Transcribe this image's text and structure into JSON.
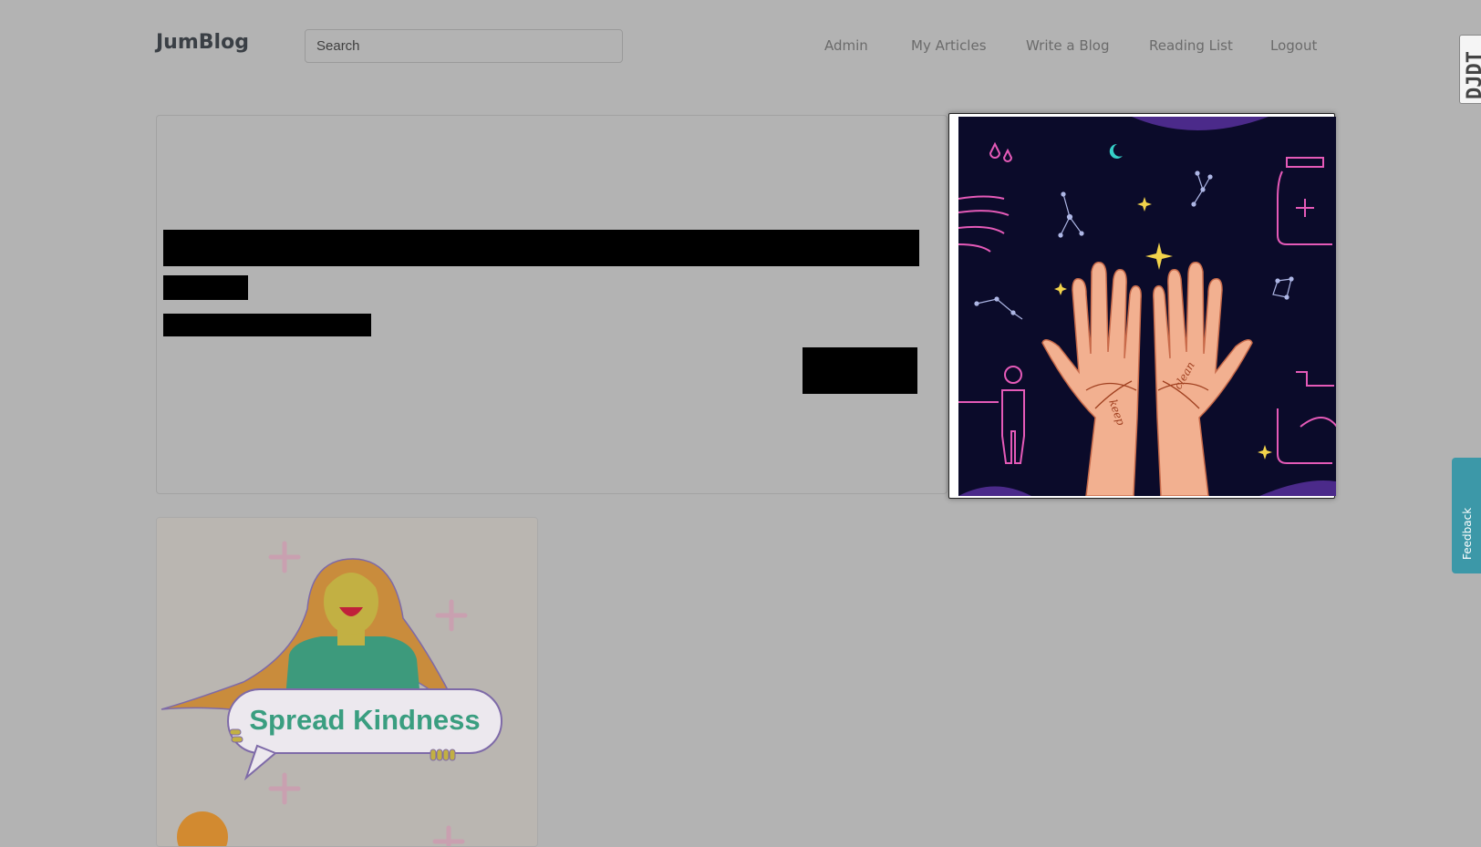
{
  "header": {
    "brand": "JumBlog",
    "search_placeholder": "Search",
    "nav": [
      {
        "label": "Admin"
      },
      {
        "label": "My Articles"
      },
      {
        "label": "Write a Blog"
      },
      {
        "label": "Reading List"
      },
      {
        "label": "Logout"
      }
    ]
  },
  "popup_image": {
    "palm_words": [
      "keep",
      "clean"
    ]
  },
  "card2": {
    "image_text": "Spread Kindness"
  },
  "side_tabs": {
    "top_tab_text": "DJDT",
    "feedback": "Feedback"
  },
  "colors": {
    "overlay": "#b3b3b3",
    "feedback_tab": "#3c98a8",
    "night_sky": "#0b0b2a",
    "kindness_green": "#3a9e80"
  }
}
